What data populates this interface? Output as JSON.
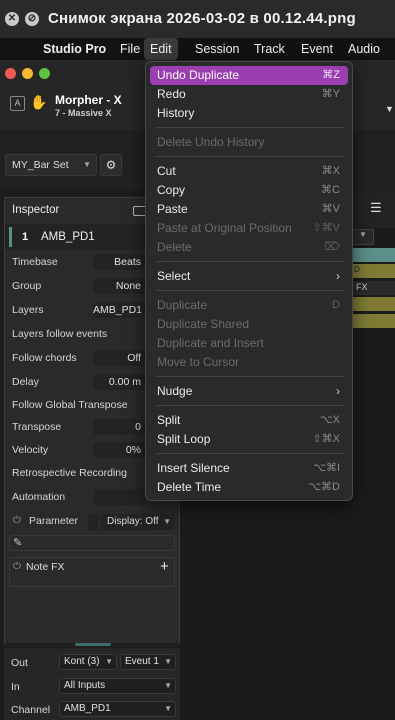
{
  "window": {
    "title": "Снимок экрана 2026-03-02 в 00.12.44.png"
  },
  "menubar": {
    "app": "Studio Pro",
    "items": [
      "File",
      "Edit",
      "Session",
      "Track",
      "Event",
      "Audio"
    ]
  },
  "toolbar": {
    "instrument_name": "Morpher - X",
    "instrument_sub": "7 - Massive X",
    "bar_set": "MY_Bar Set"
  },
  "inspector": {
    "title": "Inspector",
    "track_number": "1",
    "track_name": "AMB_PD1",
    "rows": {
      "timebase": {
        "label": "Timebase",
        "value": "Beats"
      },
      "group": {
        "label": "Group",
        "value": "None"
      },
      "layers": {
        "label": "Layers",
        "value": "AMB_PD1"
      },
      "layers_follow": "Layers follow events",
      "follow_chords": {
        "label": "Follow chords",
        "value": "Off"
      },
      "delay": {
        "label": "Delay",
        "value": "0.00 m"
      },
      "follow_transpose": "Follow Global Transpose",
      "transpose": {
        "label": "Transpose",
        "value": "0"
      },
      "velocity": {
        "label": "Velocity",
        "value": "0%"
      },
      "retro": "Retrospective Recording",
      "automation": "Automation",
      "parameter": "Parameter",
      "display": "Display: Off",
      "note_fx": "Note FX",
      "note_fx_add": "+"
    }
  },
  "bottom": {
    "out_label": "Out",
    "out_value": "Kont (3)",
    "out_value2": "Eveut 1",
    "in_label": "In",
    "in_value": "All Inputs",
    "channel_label": "Channel",
    "channel_value": "AMB_PD1"
  },
  "tracks": {
    "fx_label": "FX",
    "d_label": "D"
  },
  "edit_menu": {
    "items": [
      {
        "label": "Undo Duplicate",
        "shortcut": "⌘Z",
        "state": "highlight"
      },
      {
        "label": "Redo",
        "shortcut": "⌘Y",
        "state": "enabled"
      },
      {
        "label": "History",
        "shortcut": "",
        "state": "enabled"
      },
      {
        "label": "Delete Undo History",
        "shortcut": "",
        "state": "disabled"
      },
      {
        "label": "Cut",
        "shortcut": "⌘X",
        "state": "enabled"
      },
      {
        "label": "Copy",
        "shortcut": "⌘C",
        "state": "enabled"
      },
      {
        "label": "Paste",
        "shortcut": "⌘V",
        "state": "enabled"
      },
      {
        "label": "Paste at Original Position",
        "shortcut": "⇧⌘V",
        "state": "disabled"
      },
      {
        "label": "Delete",
        "shortcut": "⌦",
        "state": "disabled"
      },
      {
        "label": "Select",
        "shortcut": "",
        "state": "submenu"
      },
      {
        "label": "Duplicate",
        "shortcut": "D",
        "state": "disabled"
      },
      {
        "label": "Duplicate Shared",
        "shortcut": "",
        "state": "disabled"
      },
      {
        "label": "Duplicate and Insert",
        "shortcut": "",
        "state": "disabled"
      },
      {
        "label": "Move to Cursor",
        "shortcut": "",
        "state": "disabled"
      },
      {
        "label": "Nudge",
        "shortcut": "",
        "state": "submenu"
      },
      {
        "label": "Split",
        "shortcut": "⌥X",
        "state": "enabled"
      },
      {
        "label": "Split Loop",
        "shortcut": "⇧⌘X",
        "state": "enabled"
      },
      {
        "label": "Insert Silence",
        "shortcut": "⌥⌘I",
        "state": "enabled"
      },
      {
        "label": "Delete Time",
        "shortcut": "⌥⌘D",
        "state": "enabled"
      }
    ]
  },
  "colors": {
    "accent": "#9b3fb0",
    "track_teal": "#5b8f8a",
    "track_olive": "#7f7b35"
  }
}
